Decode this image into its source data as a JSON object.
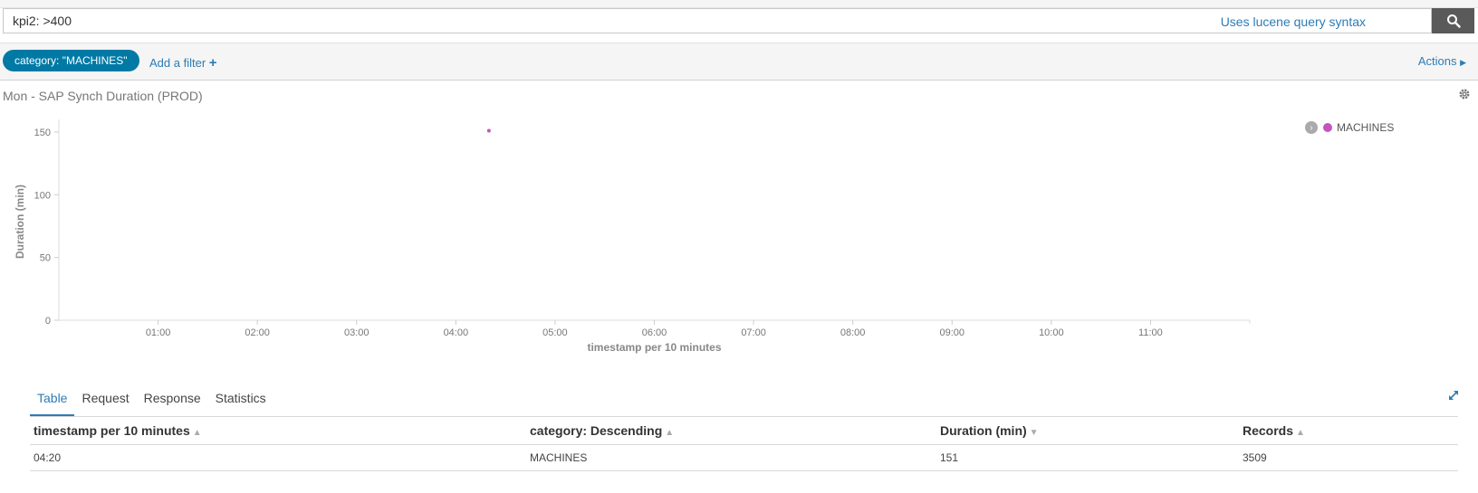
{
  "search": {
    "query": "kpi2: >400",
    "syntax_link": "Uses lucene query syntax"
  },
  "filters": {
    "pill_label": "category: \"MACHINES\"",
    "add_filter_label": "Add a filter",
    "actions_label": "Actions"
  },
  "panel": {
    "title": "Mon - SAP Synch Duration (PROD)"
  },
  "chart_data": {
    "type": "scatter",
    "xlabel": "timestamp per 10 minutes",
    "ylabel": "Duration (min)",
    "x_ticks": [
      "01:00",
      "02:00",
      "03:00",
      "04:00",
      "05:00",
      "06:00",
      "07:00",
      "08:00",
      "09:00",
      "10:00",
      "11:00"
    ],
    "y_ticks": [
      0,
      50,
      100,
      150
    ],
    "ylim": [
      0,
      160
    ],
    "xlim_hours": [
      0,
      12
    ],
    "grid": false,
    "legend_position": "top-right",
    "series": [
      {
        "name": "MACHINES",
        "color": "#c255c0",
        "points": [
          {
            "x": "04:20",
            "y": 151
          }
        ]
      }
    ]
  },
  "tabs": [
    {
      "label": "Table",
      "active": true
    },
    {
      "label": "Request",
      "active": false
    },
    {
      "label": "Response",
      "active": false
    },
    {
      "label": "Statistics",
      "active": false
    }
  ],
  "table": {
    "columns": [
      "timestamp per 10 minutes",
      "category: Descending",
      "Duration (min)",
      "Records"
    ],
    "rows": [
      [
        "04:20",
        "MACHINES",
        "151",
        "3509"
      ]
    ]
  }
}
